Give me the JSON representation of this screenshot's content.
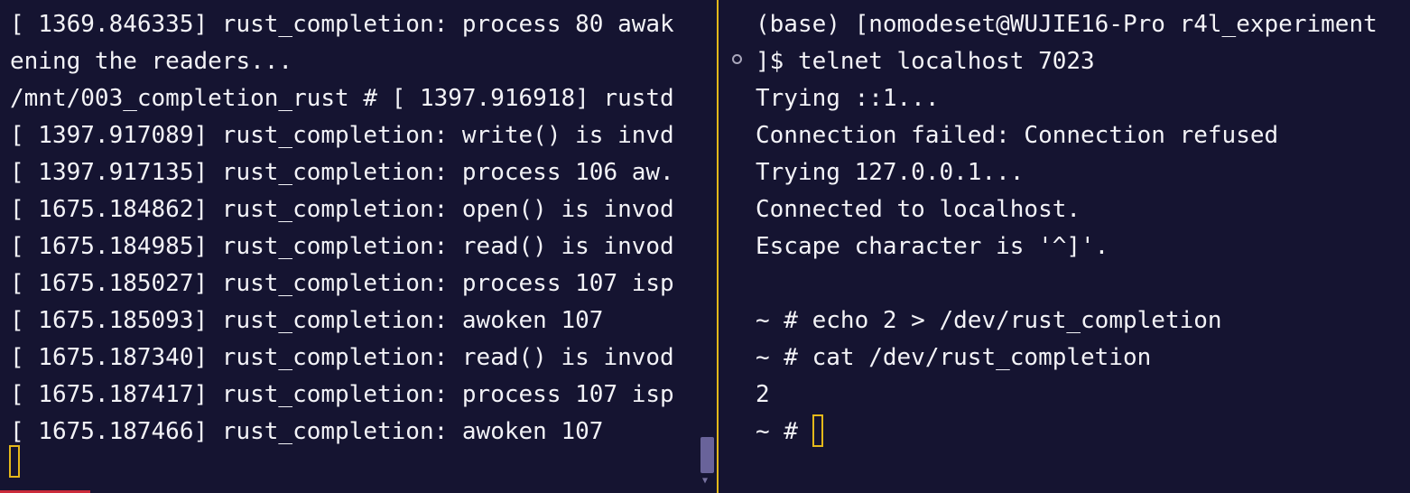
{
  "left_pane": {
    "lines": [
      "[ 1369.846335] rust_completion: process 80 awak",
      "ening the readers...",
      "/mnt/003_completion_rust # [ 1397.916918] rustd",
      "[ 1397.917089] rust_completion: write() is invd",
      "[ 1397.917135] rust_completion: process 106 aw.",
      "[ 1675.184862] rust_completion: open() is invod",
      "[ 1675.184985] rust_completion: read() is invod",
      "[ 1675.185027] rust_completion: process 107 isp",
      "[ 1675.185093] rust_completion: awoken 107",
      "[ 1675.187340] rust_completion: read() is invod",
      "[ 1675.187417] rust_completion: process 107 isp",
      "[ 1675.187466] rust_completion: awoken 107"
    ]
  },
  "right_pane": {
    "lines": [
      "(base) [nomodeset@WUJIE16-Pro r4l_experiment",
      "]$ telnet localhost 7023",
      "Trying ::1...",
      "Connection failed: Connection refused",
      "Trying 127.0.0.1...",
      "Connected to localhost.",
      "Escape character is '^]'.",
      "",
      "~ # echo 2 > /dev/rust_completion",
      "~ # cat /dev/rust_completion",
      "2"
    ],
    "prompt": "~ # "
  },
  "colors": {
    "background": "#151431",
    "text": "#f3f3f7",
    "divider_accent": "#e4b81a",
    "cursor": "#e4b81a",
    "scrollbar": "#69639a",
    "status_accent": "#cb2b3b"
  },
  "icons": {
    "prompt_marker": "hollow-circle",
    "cursor": "block-outline-cursor",
    "scroll_arrow": "down-triangle"
  }
}
